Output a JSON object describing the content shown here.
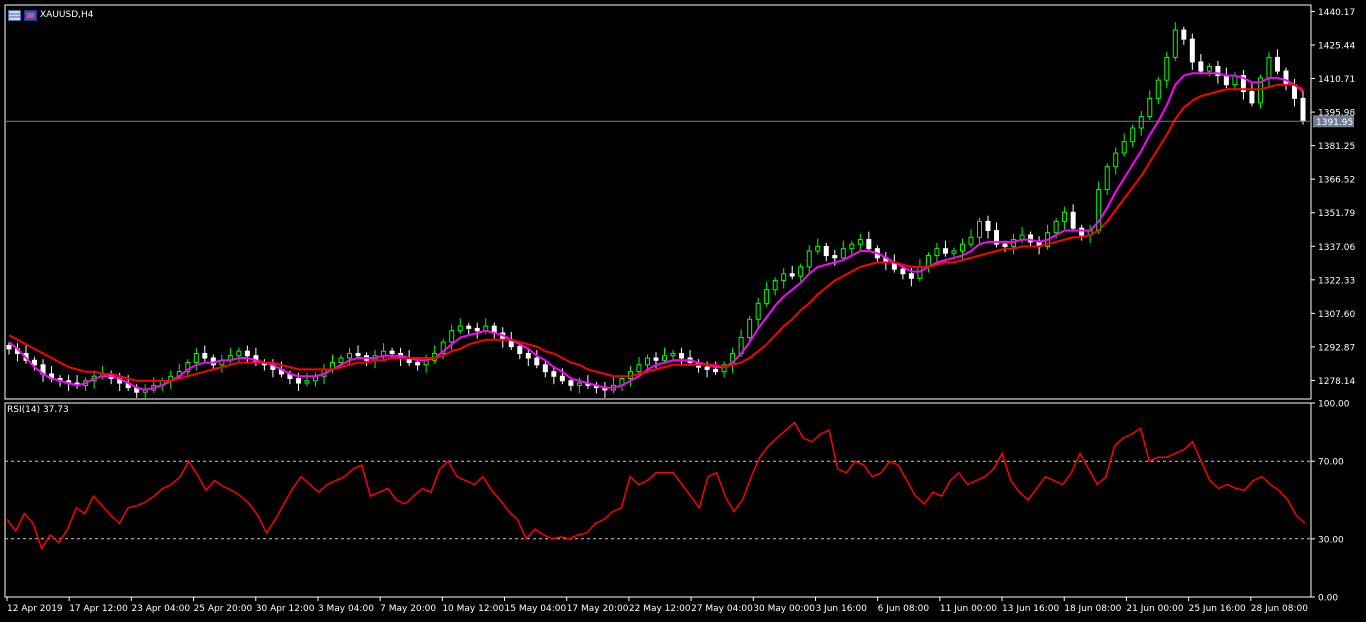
{
  "window": {
    "title": "XAUUSD,H4"
  },
  "colors": {
    "background": "#000000",
    "grid": "#ffffff",
    "candle_up": "#00ff00",
    "candle_down": "#ffffff",
    "ma_fast": "#ff00ff",
    "ma_slow": "#ff0000",
    "rsi_line": "#ff0000",
    "price_line": "#6d7b93",
    "price_label_bg": "#6d7b93"
  },
  "icons": {
    "symbol_icon": "chart-window-icon"
  },
  "chart_data": [
    {
      "type": "candlestick",
      "title": "XAUUSD,H4",
      "ylim": [
        1270,
        1443
      ],
      "y_ticks": [
        "1440.17",
        "1425.44",
        "1410.71",
        "1395.98",
        "1381.25",
        "1366.52",
        "1351.79",
        "1337.06",
        "1322.33",
        "1307.60",
        "1292.87",
        "1278.14"
      ],
      "x_tick_labels": [
        "12 Apr 2019",
        "17 Apr 12:00",
        "23 Apr 04:00",
        "25 Apr 20:00",
        "30 Apr 12:00",
        "3 May 04:00",
        "7 May 20:00",
        "10 May 12:00",
        "15 May 04:00",
        "17 May 20:00",
        "22 May 12:00",
        "27 May 04:00",
        "30 May 00:00",
        "3 Jun 16:00",
        "6 Jun 08:00",
        "11 Jun 00:00",
        "13 Jun 16:00",
        "18 Jun 08:00",
        "21 Jun 00:00",
        "25 Jun 16:00",
        "28 Jun 08:00"
      ],
      "current_price": "1391.95",
      "close_series": [
        1292,
        1290,
        1287,
        1285,
        1281,
        1279,
        1278,
        1277,
        1276,
        1278,
        1280,
        1281,
        1279,
        1277,
        1275,
        1273,
        1274,
        1276,
        1278,
        1280,
        1282,
        1286,
        1290,
        1288,
        1285,
        1287,
        1289,
        1291,
        1289,
        1286,
        1285,
        1283,
        1281,
        1279,
        1277,
        1278,
        1280,
        1283,
        1286,
        1288,
        1290,
        1289,
        1287,
        1289,
        1291,
        1290,
        1288,
        1286,
        1285,
        1287,
        1290,
        1295,
        1300,
        1302,
        1301,
        1300,
        1302,
        1299,
        1296,
        1293,
        1290,
        1288,
        1285,
        1282,
        1280,
        1278,
        1276,
        1277,
        1276,
        1275,
        1274,
        1276,
        1279,
        1282,
        1285,
        1288,
        1287,
        1289,
        1290,
        1288,
        1286,
        1284,
        1283,
        1282,
        1285,
        1290,
        1297,
        1305,
        1312,
        1318,
        1322,
        1325,
        1324,
        1328,
        1335,
        1337,
        1333,
        1332,
        1336,
        1338,
        1340,
        1336,
        1332,
        1330,
        1327,
        1325,
        1323,
        1328,
        1333,
        1336,
        1334,
        1335,
        1338,
        1341,
        1348,
        1344,
        1338,
        1337,
        1340,
        1342,
        1339,
        1337,
        1343,
        1348,
        1352,
        1345,
        1342,
        1344,
        1362,
        1372,
        1378,
        1383,
        1389,
        1394,
        1402,
        1410,
        1420,
        1432,
        1428,
        1418,
        1414,
        1416,
        1412,
        1408,
        1412,
        1405,
        1400,
        1411,
        1420,
        1414,
        1408,
        1402,
        1392
      ],
      "series": [
        {
          "name": "ma_fast",
          "values": [
            1295,
            1292,
            1288,
            1284,
            1281,
            1279,
            1278,
            1277,
            1276,
            1277,
            1279,
            1280,
            1280,
            1279,
            1277,
            1275,
            1274,
            1275,
            1276,
            1278,
            1280,
            1283,
            1285,
            1286,
            1286,
            1287,
            1287,
            1288,
            1288,
            1287,
            1286,
            1285,
            1283,
            1281,
            1280,
            1280,
            1280,
            1281,
            1283,
            1285,
            1287,
            1288,
            1288,
            1288,
            1289,
            1289,
            1289,
            1288,
            1287,
            1287,
            1288,
            1291,
            1294,
            1297,
            1298,
            1299,
            1300,
            1299,
            1298,
            1296,
            1294,
            1292,
            1289,
            1287,
            1284,
            1282,
            1279,
            1278,
            1277,
            1276,
            1275,
            1275,
            1276,
            1278,
            1280,
            1283,
            1285,
            1286,
            1287,
            1287,
            1287,
            1286,
            1285,
            1284,
            1284,
            1286,
            1290,
            1295,
            1301,
            1306,
            1311,
            1315,
            1318,
            1321,
            1325,
            1328,
            1329,
            1330,
            1331,
            1333,
            1335,
            1335,
            1334,
            1332,
            1330,
            1328,
            1326,
            1326,
            1328,
            1330,
            1331,
            1332,
            1333,
            1335,
            1338,
            1339,
            1339,
            1339,
            1339,
            1340,
            1340,
            1339,
            1340,
            1342,
            1344,
            1344,
            1344,
            1344,
            1348,
            1354,
            1361,
            1367,
            1373,
            1379,
            1386,
            1392,
            1399,
            1408,
            1412,
            1413,
            1413,
            1413,
            1413,
            1412,
            1412,
            1411,
            1409,
            1409,
            1411,
            1411,
            1410,
            1408,
            1405
          ]
        },
        {
          "name": "ma_slow",
          "values": [
            1298,
            1296,
            1294,
            1292,
            1290,
            1288,
            1286,
            1284,
            1283,
            1282,
            1282,
            1281,
            1281,
            1280,
            1279,
            1278,
            1278,
            1278,
            1278,
            1278,
            1279,
            1280,
            1281,
            1282,
            1283,
            1284,
            1285,
            1286,
            1286,
            1286,
            1286,
            1286,
            1285,
            1284,
            1283,
            1283,
            1283,
            1283,
            1283,
            1284,
            1285,
            1286,
            1286,
            1287,
            1287,
            1288,
            1288,
            1288,
            1288,
            1288,
            1288,
            1289,
            1291,
            1292,
            1294,
            1295,
            1296,
            1296,
            1296,
            1296,
            1295,
            1294,
            1293,
            1291,
            1290,
            1288,
            1286,
            1285,
            1283,
            1282,
            1281,
            1280,
            1280,
            1280,
            1281,
            1282,
            1283,
            1284,
            1285,
            1285,
            1285,
            1285,
            1285,
            1285,
            1284,
            1285,
            1286,
            1288,
            1291,
            1294,
            1298,
            1302,
            1305,
            1309,
            1312,
            1316,
            1319,
            1322,
            1324,
            1326,
            1328,
            1329,
            1330,
            1330,
            1330,
            1329,
            1328,
            1328,
            1328,
            1329,
            1330,
            1330,
            1331,
            1332,
            1333,
            1334,
            1335,
            1336,
            1336,
            1337,
            1337,
            1337,
            1338,
            1339,
            1340,
            1341,
            1341,
            1342,
            1344,
            1348,
            1353,
            1358,
            1363,
            1368,
            1374,
            1380,
            1386,
            1393,
            1398,
            1401,
            1403,
            1404,
            1405,
            1406,
            1406,
            1406,
            1406,
            1406,
            1407,
            1408,
            1408,
            1408,
            1406
          ]
        }
      ]
    },
    {
      "type": "line",
      "title": "RSI(14) 37.73",
      "ylim": [
        0,
        100
      ],
      "y_ticks": [
        "100.00",
        "70.00",
        "30.00",
        "0.00"
      ],
      "levels": [
        70,
        30
      ],
      "series": [
        {
          "name": "RSI(14)",
          "values": [
            40,
            34,
            43,
            38,
            25,
            32,
            28,
            35,
            46,
            43,
            52,
            47,
            42,
            38,
            46,
            47,
            49,
            52,
            56,
            58,
            62,
            70,
            63,
            55,
            60,
            57,
            55,
            52,
            48,
            42,
            33,
            40,
            48,
            56,
            62,
            58,
            54,
            58,
            60,
            62,
            66,
            68,
            52,
            54,
            56,
            50,
            48,
            52,
            56,
            54,
            66,
            70,
            62,
            60,
            58,
            62,
            55,
            50,
            44,
            40,
            30,
            35,
            32,
            30,
            31,
            30,
            32,
            33,
            38,
            40,
            44,
            46,
            62,
            58,
            60,
            64,
            64,
            64,
            58,
            52,
            46,
            62,
            64,
            52,
            44,
            50,
            62,
            72,
            78,
            82,
            86,
            90,
            82,
            80,
            84,
            86,
            66,
            64,
            70,
            68,
            62,
            64,
            70,
            68,
            60,
            52,
            48,
            54,
            52,
            60,
            64,
            58,
            60,
            62,
            66,
            74,
            60,
            54,
            50,
            56,
            62,
            60,
            58,
            64,
            74,
            66,
            58,
            62,
            78,
            82,
            84,
            87,
            70,
            72,
            72,
            74,
            76,
            80,
            70,
            60,
            56,
            58,
            56,
            55,
            60,
            62,
            58,
            55,
            50,
            42,
            38
          ]
        }
      ]
    }
  ]
}
